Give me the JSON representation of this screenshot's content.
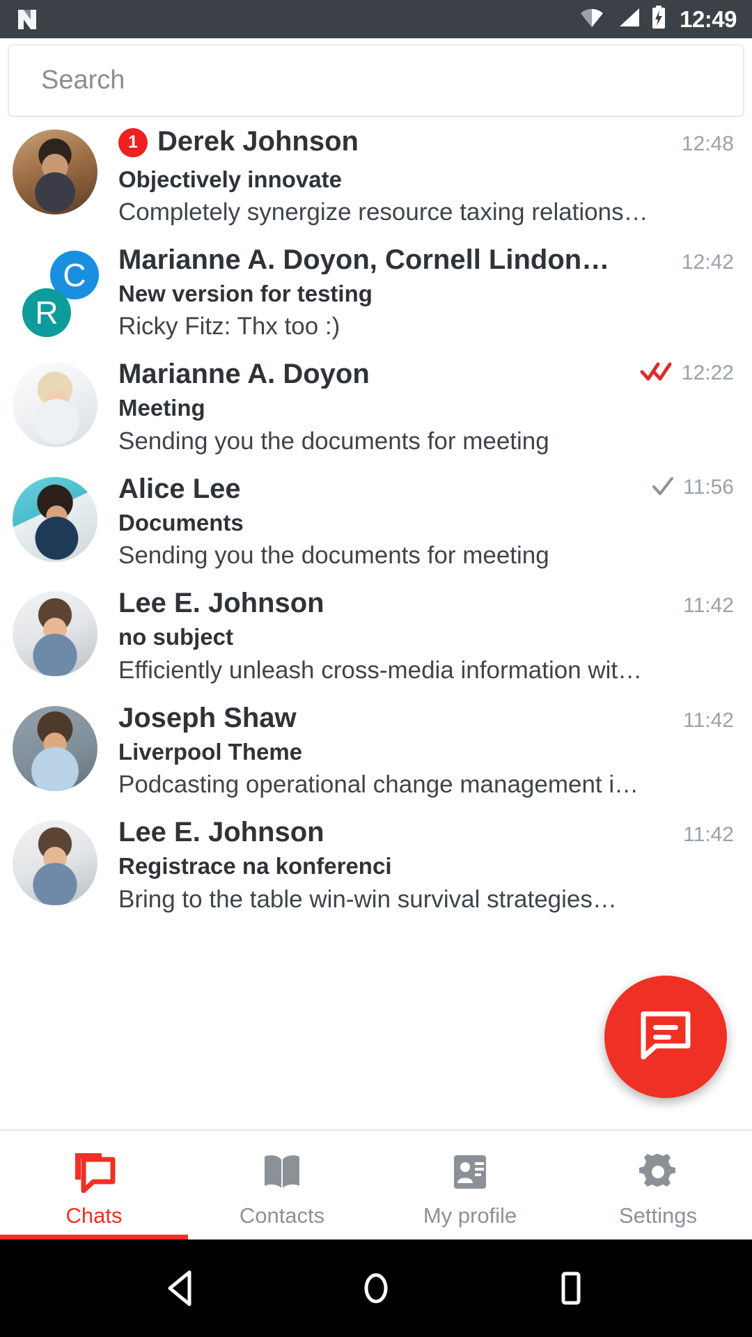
{
  "statusbar": {
    "logo_icon": "android-n-logo",
    "wifi_icon": "wifi-icon",
    "signal_icon": "cell-signal-icon",
    "battery_icon": "battery-charging-icon",
    "clock": "12:49"
  },
  "search": {
    "placeholder": "Search",
    "value": ""
  },
  "colors": {
    "accent_red": "#ee3124",
    "badge_red": "#ee2020",
    "read_tick_red": "#dd2b2b",
    "sent_tick_gray": "#8b9197",
    "statusbar_bg": "#3c4148",
    "group_blue": "#1a8fe0",
    "group_teal": "#0e9b9b",
    "name_text": "#2f3337",
    "time_text": "#9aa1a8"
  },
  "chats": [
    {
      "name": "Derek Johnson",
      "subject": "Objectively innovate",
      "preview": "Completely synergize resource taxing relations…",
      "time": "12:48",
      "badge": "1",
      "tick": "none",
      "avatar_type": "photo",
      "avatar_class": "ph-derek"
    },
    {
      "name": "Marianne A. Doyon, Cornell Lindon…",
      "subject": "New version for testing",
      "preview": "Ricky Fitz: Thx too :)",
      "time": "12:42",
      "badge": "",
      "tick": "none",
      "avatar_type": "group",
      "avatar_class": "ph-marianne",
      "group_initials": [
        "C",
        "R"
      ]
    },
    {
      "name": "Marianne A. Doyon",
      "subject": "Meeting",
      "preview": "Sending you the documents for meeting",
      "time": "12:22",
      "badge": "",
      "tick": "read",
      "avatar_type": "photo",
      "avatar_class": "ph-marianne"
    },
    {
      "name": "Alice Lee",
      "subject": "Documents",
      "preview": "Sending you the documents for meeting",
      "time": "11:56",
      "badge": "",
      "tick": "sent",
      "avatar_type": "photo",
      "avatar_class": "ph-alice"
    },
    {
      "name": "Lee E. Johnson",
      "subject": "no subject",
      "preview": "Efficiently unleash cross-media information wit…",
      "time": "11:42",
      "badge": "",
      "tick": "none",
      "avatar_type": "photo",
      "avatar_class": "ph-lee"
    },
    {
      "name": "Joseph Shaw",
      "subject": "Liverpool Theme",
      "preview": "Podcasting operational change management i…",
      "time": "11:42",
      "badge": "",
      "tick": "none",
      "avatar_type": "photo",
      "avatar_class": "ph-joseph"
    },
    {
      "name": "Lee E. Johnson",
      "subject": "Registrace na konferenci",
      "preview": "Bring to the table win-win survival strategies…",
      "time": "11:42",
      "badge": "",
      "tick": "none",
      "avatar_type": "photo",
      "avatar_class": "ph-lee"
    }
  ],
  "fab": {
    "icon": "new-message-icon",
    "label": ""
  },
  "bottom_nav": {
    "items": [
      {
        "label": "Chats",
        "icon": "chats-icon",
        "active": true
      },
      {
        "label": "Contacts",
        "icon": "contacts-book-icon",
        "active": false
      },
      {
        "label": "My profile",
        "icon": "profile-card-icon",
        "active": false
      },
      {
        "label": "Settings",
        "icon": "gear-icon",
        "active": false
      }
    ]
  },
  "android_nav": {
    "back_icon": "back-triangle-icon",
    "home_icon": "home-circle-icon",
    "recents_icon": "recents-square-icon"
  }
}
